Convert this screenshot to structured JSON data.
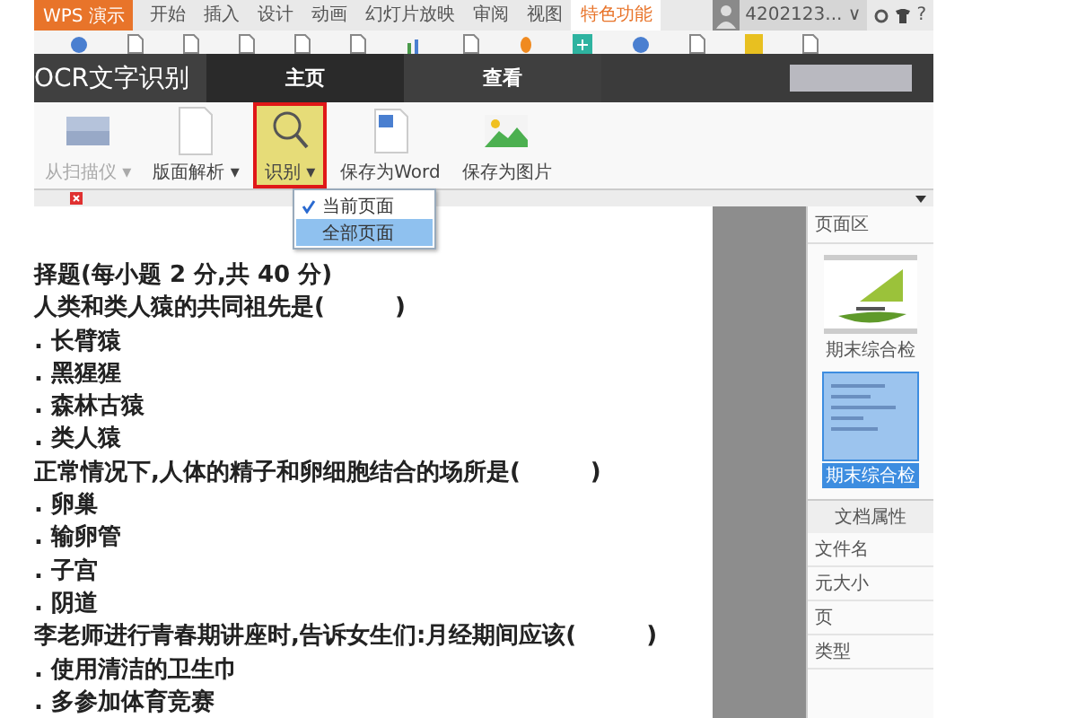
{
  "app_menu": {
    "label": "WPS 演示"
  },
  "ribbon_tabs": [
    {
      "label": "开始",
      "selected": false
    },
    {
      "label": "插入",
      "selected": false
    },
    {
      "label": "设计",
      "selected": false
    },
    {
      "label": "动画",
      "selected": false
    },
    {
      "label": "幻灯片放映",
      "selected": false
    },
    {
      "label": "审阅",
      "selected": false
    },
    {
      "label": "视图",
      "selected": false
    },
    {
      "label": "特色功能",
      "selected": true
    }
  ],
  "account": {
    "name": "4202123... ∨",
    "help": "?"
  },
  "ocr": {
    "title": "OCR文字识别",
    "tabs": [
      {
        "label": "主页",
        "selected": true
      },
      {
        "label": "查看",
        "selected": false
      }
    ]
  },
  "toolbar": [
    {
      "label": "从扫描仪 ▾",
      "kind": "scanner",
      "disabled": true,
      "active": false
    },
    {
      "label": "版面解析 ▾",
      "kind": "layout",
      "disabled": false,
      "active": false
    },
    {
      "label": "识别 ▾",
      "kind": "recognize",
      "disabled": false,
      "active": true
    },
    {
      "label": "保存为Word",
      "kind": "word",
      "disabled": false,
      "active": false
    },
    {
      "label": "保存为图片",
      "kind": "image",
      "disabled": false,
      "active": false
    }
  ],
  "recognize_menu": [
    {
      "label": "当前页面",
      "checked": true,
      "selected": false
    },
    {
      "label": "全部页面",
      "checked": false,
      "selected": true
    }
  ],
  "document": {
    "lines": [
      "择题(每小题 2 分,共 40 分)",
      "人类和类人猿的共同祖先是(　　　)",
      ". 长臂猿",
      ". 黑猩猩",
      ". 森林古猿",
      ". 类人猿",
      "正常情况下,人体的精子和卵细胞结合的场所是(　　　)",
      ". 卵巢",
      ". 输卵管",
      ". 子宫",
      ". 阴道",
      "李老师进行青春期讲座时,告诉女生们:月经期间应该(　　　)",
      ". 使用清洁的卫生巾",
      ". 多参加体育竞赛"
    ]
  },
  "page_panel": {
    "title": "页面区",
    "pages": [
      {
        "label": "期末综合检",
        "selected": false
      },
      {
        "label": "期末综合检",
        "selected": true
      }
    ]
  },
  "properties": {
    "title": "文档属性",
    "rows": [
      "文件名",
      "元大小",
      "页",
      "类型"
    ]
  }
}
